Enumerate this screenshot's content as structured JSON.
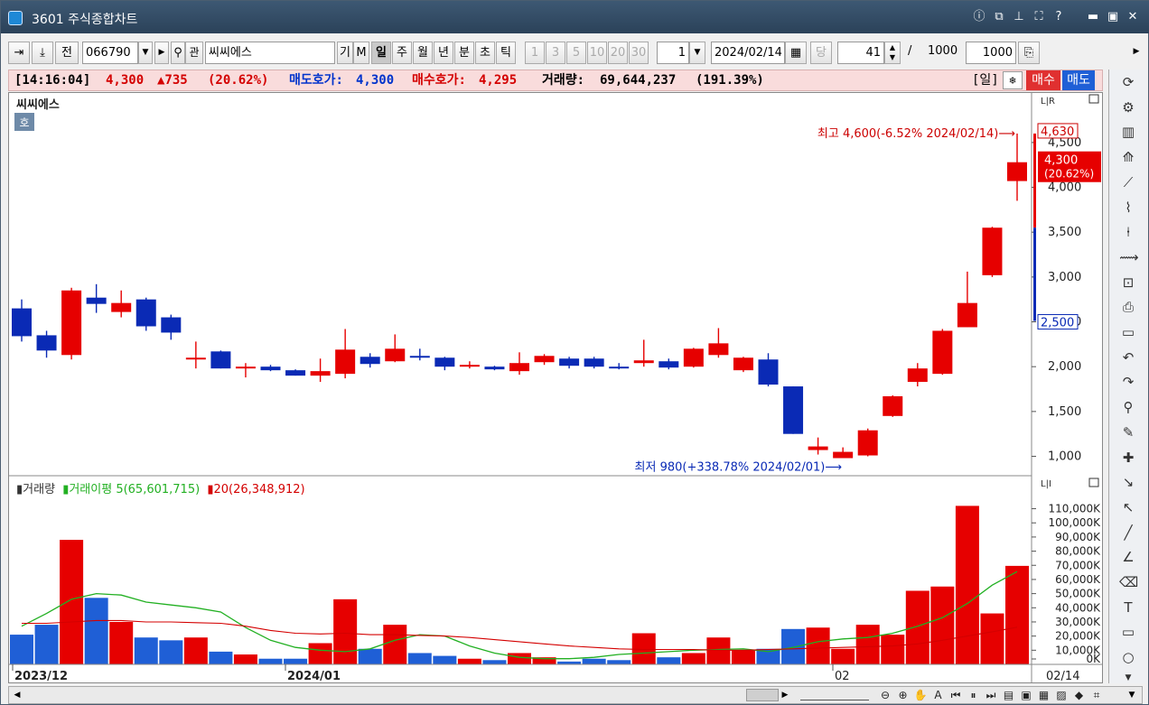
{
  "window": {
    "title": "3601 주식종합차트"
  },
  "titlebar_icons": [
    "info-icon",
    "window-split-icon",
    "pin-icon",
    "maximize-icon",
    "help-icon",
    "minimize-icon",
    "restore-icon",
    "close-icon"
  ],
  "toolbar": {
    "prev_label": "전",
    "code": "066790",
    "search_label": "관",
    "name": "씨씨에스",
    "gi_label": "기",
    "m_label": "M",
    "periods": [
      "일",
      "주",
      "월",
      "년",
      "분",
      "초",
      "틱"
    ],
    "selected_period": "일",
    "intervals": [
      "1",
      "3",
      "5",
      "10",
      "20",
      "30"
    ],
    "interval_value": "1",
    "date": "2024/02/14",
    "dang_label": "당",
    "count": "41",
    "slash": "/",
    "total": "1000",
    "view_count": "1000"
  },
  "quote": {
    "time": "[14:16:04]",
    "price": "4,300",
    "change": "▲735",
    "change_pct": "(20.62%)",
    "ask_label": "매도호가:",
    "ask_value": "4,300",
    "bid_label": "매수호가:",
    "bid_value": "4,295",
    "volume_label": "거래량:",
    "volume_value": "69,644,237",
    "volume_pct": "(191.39%)",
    "period_tag": "[일]",
    "buy_label": "매수",
    "sell_label": "매도"
  },
  "price_panel": {
    "title": "씨씨에스",
    "badge": "호",
    "scale_tag": "L|R",
    "high_annotation": "최고 4,600(-6.52% 2024/02/14)⟶",
    "low_annotation": "최저 980(+338.78% 2024/02/01)⟶",
    "axis_top_tag": "4,630",
    "current_tag_price": "4,300",
    "current_tag_pct": "(20.62%)",
    "axis_bottom_tag": "2,500",
    "y_ticks": [
      "4,500",
      "4,000",
      "3,500",
      "3,000",
      "2,500",
      "2,000",
      "1,500",
      "1,000"
    ]
  },
  "volume_panel": {
    "legend_volume": "거래량",
    "legend_ma5": "거래이평 5(65,601,715)",
    "legend_ma20": "20(26,348,912)",
    "scale_tag": "L|I",
    "y_ticks": [
      "110,000K",
      "100,000K",
      "90,000K",
      "80,000K",
      "70,000K",
      "60,000K",
      "50,000K",
      "40,000K",
      "30,000K",
      "20,000K",
      "10,000K",
      "0K"
    ]
  },
  "x_axis": {
    "labels": [
      "2023/12",
      "2024/01",
      "02"
    ],
    "cursor_date": "02/14"
  },
  "colors": {
    "up": "#e60000",
    "down": "#0a2ab5",
    "vol_up": "#e60000",
    "vol_down": "#1f5fd6",
    "ma5": "#22b022",
    "ma20": "#d40000"
  },
  "chart_data": {
    "type": "candlestick",
    "ylim": [
      850,
      4700
    ],
    "volume_ylim": [
      0,
      118000
    ],
    "candles": [
      {
        "o": 2650,
        "h": 2750,
        "l": 2280,
        "c": 2340,
        "v": 21000
      },
      {
        "o": 2350,
        "h": 2400,
        "l": 2100,
        "c": 2180,
        "v": 28000
      },
      {
        "o": 2130,
        "h": 2880,
        "l": 2080,
        "c": 2850,
        "v": 88000
      },
      {
        "o": 2770,
        "h": 2920,
        "l": 2600,
        "c": 2700,
        "v": 47000
      },
      {
        "o": 2610,
        "h": 2850,
        "l": 2550,
        "c": 2710,
        "v": 30000
      },
      {
        "o": 2750,
        "h": 2770,
        "l": 2400,
        "c": 2450,
        "v": 19000
      },
      {
        "o": 2550,
        "h": 2580,
        "l": 2300,
        "c": 2380,
        "v": 17000
      },
      {
        "o": 2100,
        "h": 2280,
        "l": 1980,
        "c": 2100,
        "v": 19000
      },
      {
        "o": 2170,
        "h": 2180,
        "l": 1980,
        "c": 1980,
        "v": 9000
      },
      {
        "o": 1980,
        "h": 2040,
        "l": 1880,
        "c": 2000,
        "v": 7000
      },
      {
        "o": 2000,
        "h": 2020,
        "l": 1950,
        "c": 1960,
        "v": 4000
      },
      {
        "o": 1960,
        "h": 1970,
        "l": 1900,
        "c": 1900,
        "v": 4000
      },
      {
        "o": 1900,
        "h": 2090,
        "l": 1830,
        "c": 1950,
        "v": 15000
      },
      {
        "o": 1920,
        "h": 2420,
        "l": 1870,
        "c": 2190,
        "v": 46000
      },
      {
        "o": 2110,
        "h": 2150,
        "l": 1990,
        "c": 2030,
        "v": 11000
      },
      {
        "o": 2060,
        "h": 2360,
        "l": 2050,
        "c": 2200,
        "v": 28000
      },
      {
        "o": 2120,
        "h": 2200,
        "l": 2070,
        "c": 2100,
        "v": 8000
      },
      {
        "o": 2100,
        "h": 2110,
        "l": 1960,
        "c": 2000,
        "v": 6000
      },
      {
        "o": 2010,
        "h": 2060,
        "l": 1980,
        "c": 2020,
        "v": 4000
      },
      {
        "o": 2000,
        "h": 2010,
        "l": 1960,
        "c": 1970,
        "v": 3000
      },
      {
        "o": 1950,
        "h": 2160,
        "l": 1910,
        "c": 2040,
        "v": 8000
      },
      {
        "o": 2050,
        "h": 2140,
        "l": 2020,
        "c": 2120,
        "v": 5000
      },
      {
        "o": 2090,
        "h": 2110,
        "l": 1980,
        "c": 2010,
        "v": 2000
      },
      {
        "o": 2090,
        "h": 2110,
        "l": 1980,
        "c": 2000,
        "v": 4000
      },
      {
        "o": 2000,
        "h": 2040,
        "l": 1970,
        "c": 1980,
        "v": 3000
      },
      {
        "o": 2040,
        "h": 2300,
        "l": 2000,
        "c": 2070,
        "v": 22000
      },
      {
        "o": 2060,
        "h": 2090,
        "l": 1970,
        "c": 1990,
        "v": 5000
      },
      {
        "o": 2000,
        "h": 2210,
        "l": 1990,
        "c": 2200,
        "v": 8000
      },
      {
        "o": 2130,
        "h": 2430,
        "l": 2100,
        "c": 2260,
        "v": 19000
      },
      {
        "o": 1960,
        "h": 2110,
        "l": 1940,
        "c": 2100,
        "v": 10000
      },
      {
        "o": 2080,
        "h": 2150,
        "l": 1780,
        "c": 1800,
        "v": 11000
      },
      {
        "o": 1780,
        "h": 1780,
        "l": 1250,
        "c": 1250,
        "v": 25000
      },
      {
        "o": 1070,
        "h": 1210,
        "l": 1020,
        "c": 1110,
        "v": 26000
      },
      {
        "o": 980,
        "h": 1100,
        "l": 980,
        "c": 1050,
        "v": 11000
      },
      {
        "o": 1010,
        "h": 1310,
        "l": 1000,
        "c": 1290,
        "v": 28000
      },
      {
        "o": 1450,
        "h": 1680,
        "l": 1440,
        "c": 1670,
        "v": 21000
      },
      {
        "o": 1830,
        "h": 2040,
        "l": 1780,
        "c": 1980,
        "v": 52000
      },
      {
        "o": 1920,
        "h": 2420,
        "l": 1910,
        "c": 2400,
        "v": 55000
      },
      {
        "o": 2440,
        "h": 3060,
        "l": 2440,
        "c": 2710,
        "v": 112000
      },
      {
        "o": 3020,
        "h": 3560,
        "l": 3000,
        "c": 3550,
        "v": 36000
      },
      {
        "o": 4070,
        "h": 4600,
        "l": 3850,
        "c": 4280,
        "v": 69600
      }
    ],
    "ma5": [
      27000,
      36000,
      46000,
      50000,
      49000,
      44000,
      42000,
      40000,
      37000,
      26000,
      17000,
      12000,
      10000,
      9000,
      11000,
      17000,
      21000,
      20000,
      13000,
      8000,
      5000,
      4000,
      4000,
      5000,
      7000,
      8000,
      9000,
      10000,
      10500,
      11000,
      9000,
      12000,
      16000,
      18000,
      19000,
      22000,
      27000,
      33000,
      43000,
      56000,
      65600
    ],
    "ma20": [
      29000,
      29000,
      30000,
      31000,
      31000,
      30000,
      30000,
      29500,
      29000,
      27000,
      24000,
      22000,
      21500,
      22000,
      21000,
      21000,
      20500,
      20000,
      19000,
      17500,
      16000,
      14500,
      13000,
      12000,
      11000,
      10500,
      10500,
      10500,
      10000,
      10000,
      10500,
      11000,
      11500,
      12000,
      12500,
      13000,
      14500,
      17000,
      20000,
      23000,
      26300
    ]
  }
}
